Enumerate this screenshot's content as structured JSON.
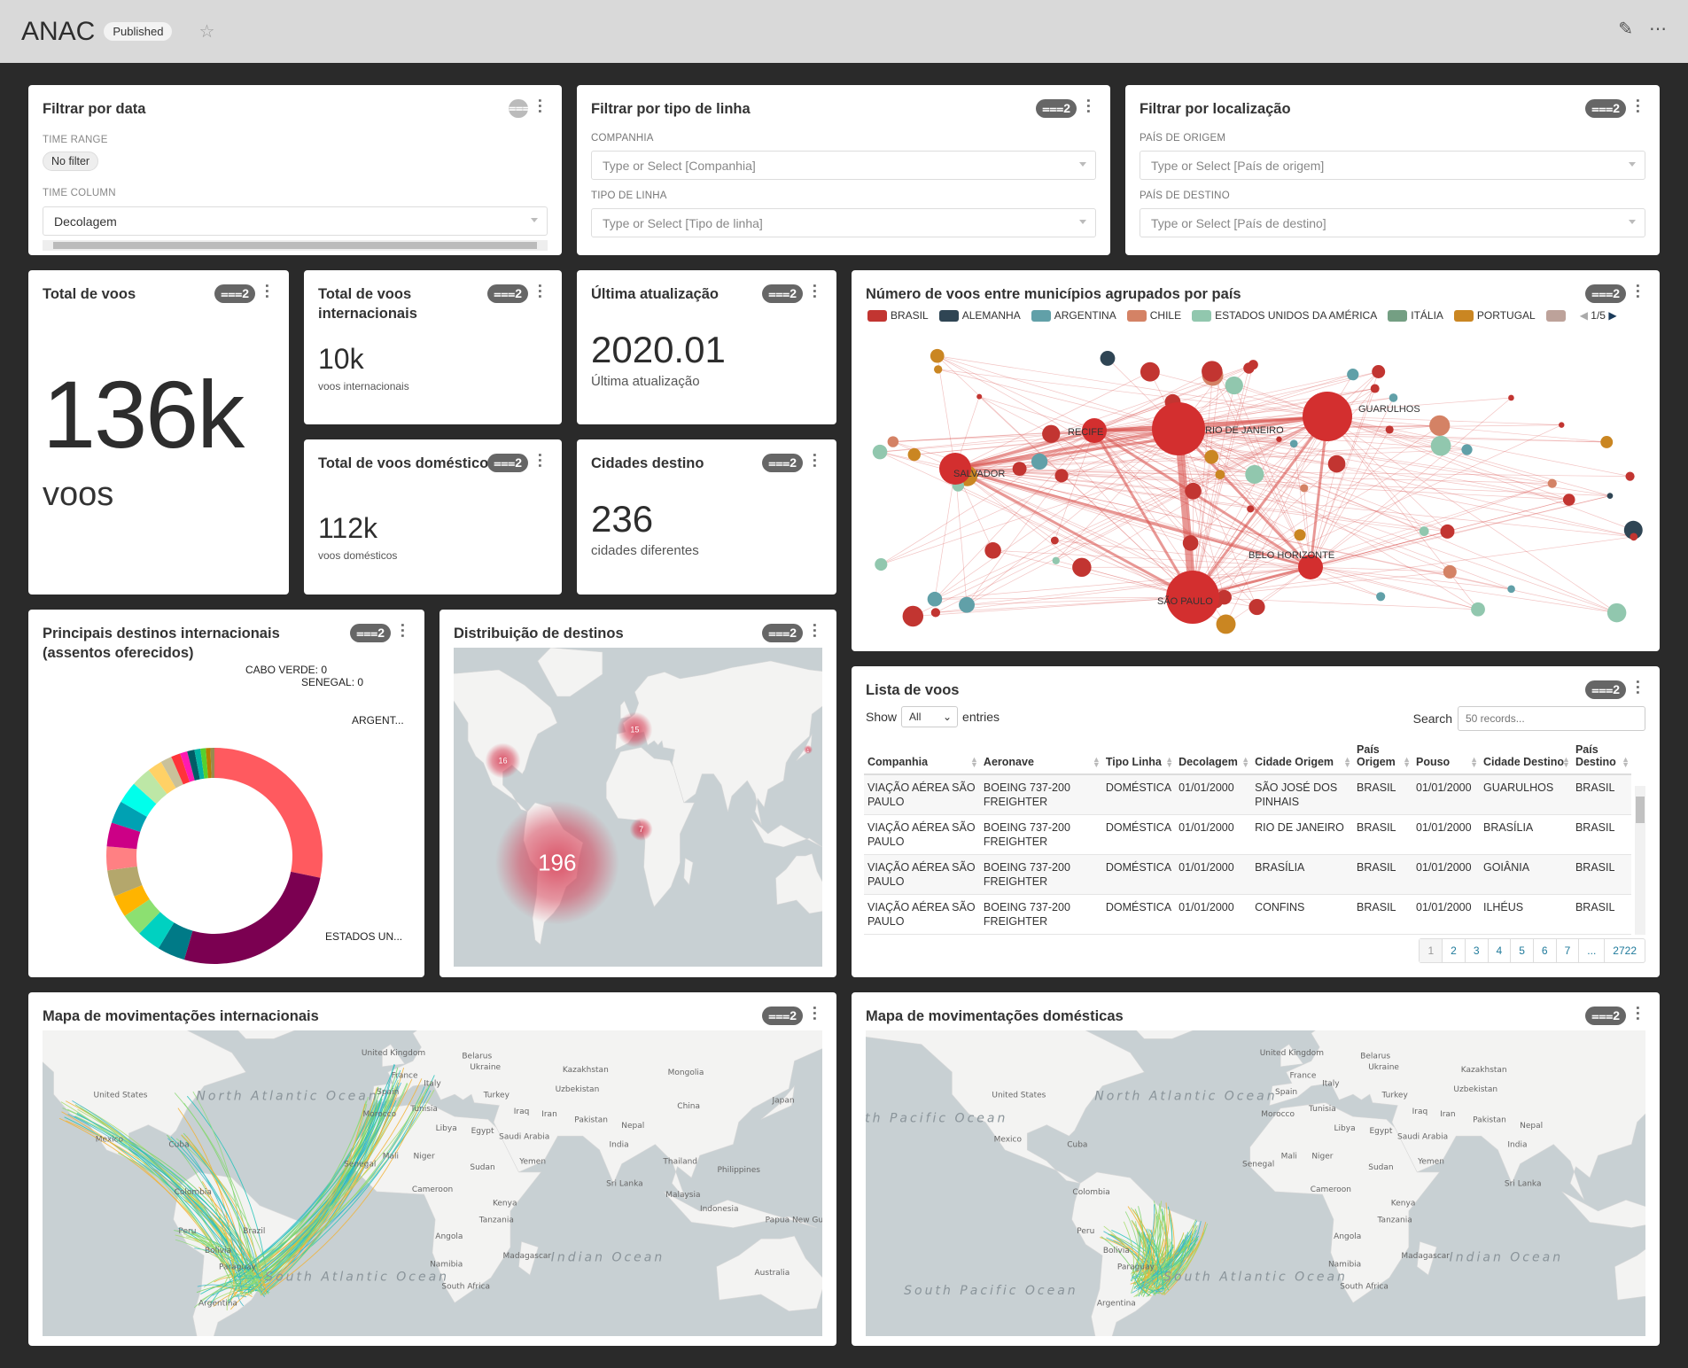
{
  "header": {
    "title": "ANAC",
    "status": "Published",
    "icons": [
      "star-icon",
      "edit-icon",
      "more-icon"
    ]
  },
  "filter_date": {
    "title": "Filtrar por data",
    "time_range_label": "TIME RANGE",
    "time_range_value": "No filter",
    "time_column_label": "TIME COLUMN",
    "time_column_value": "Decolagem"
  },
  "filter_line": {
    "title": "Filtrar por tipo de linha",
    "badge": "2",
    "companhia_label": "COMPANHIA",
    "companhia_placeholder": "Type or Select [Companhia]",
    "tipo_label": "TIPO DE LINHA",
    "tipo_placeholder": "Type or Select [Tipo de linha]"
  },
  "filter_loc": {
    "title": "Filtrar por localização",
    "badge": "2",
    "origem_label": "PAÍS DE ORIGEM",
    "origem_placeholder": "Type or Select [País de origem]",
    "destino_label": "PAÍS DE DESTINO",
    "destino_placeholder": "Type or Select [País de destino]"
  },
  "total_voos": {
    "title": "Total de voos",
    "badge": "2",
    "value": "136k",
    "unit": "voos"
  },
  "internacionais": {
    "title": "Total de voos internacionais",
    "badge": "2",
    "value": "10k",
    "subtitle": "voos internacionais"
  },
  "domesticos": {
    "title": "Total de voos domésticos",
    "badge": "2",
    "value": "112k",
    "subtitle": "voos domésticos"
  },
  "ultima": {
    "title": "Última atualização",
    "badge": "2",
    "value": "2020.01",
    "subtitle": "Última atualização"
  },
  "cidades": {
    "title": "Cidades destino",
    "badge": "2",
    "value": "236",
    "subtitle": "cidades diferentes"
  },
  "network": {
    "title": "Número de voos entre municípios agrupados por país",
    "badge": "2",
    "page": "1/5",
    "legend": [
      {
        "label": "BRASIL",
        "color": "#c23531"
      },
      {
        "label": "ALEMANHA",
        "color": "#2f4554"
      },
      {
        "label": "ARGENTINA",
        "color": "#61a0a8"
      },
      {
        "label": "CHILE",
        "color": "#d48265"
      },
      {
        "label": "ESTADOS UNIDOS DA AMÉRICA",
        "color": "#91c7ae"
      },
      {
        "label": "ITÁLIA",
        "color": "#749f83"
      },
      {
        "label": "PORTUGAL",
        "color": "#ca8622"
      },
      {
        "label": "",
        "color": "#bda29a"
      }
    ],
    "cities": [
      "RECIFE",
      "RIO DE JANEIRO",
      "GUARULHOS",
      "SALVADOR",
      "BELO HORIZONTE",
      "SÃO PAULO"
    ]
  },
  "donut": {
    "title": "Principais destinos internacionais (assentos oferecidos)",
    "badge": "2",
    "chart_data": {
      "type": "pie",
      "labels_shown": [
        "CABO VERDE: 0",
        "SENEGAL: 0",
        "ARGENT...",
        "ESTADOS UN..."
      ],
      "slices": [
        {
          "label": "ARGENTINA",
          "value": 28.5,
          "color": "#ff5a5f"
        },
        {
          "label": "ESTADOS UNIDOS",
          "value": 26.5,
          "color": "#7b0051"
        },
        {
          "value": 4.2,
          "color": "#007a87"
        },
        {
          "value": 3.6,
          "color": "#00d1c1"
        },
        {
          "value": 3.4,
          "color": "#8ce071"
        },
        {
          "value": 3.3,
          "color": "#ffb400"
        },
        {
          "value": 4.0,
          "color": "#b4a76c"
        },
        {
          "value": 3.6,
          "color": "#ff8083"
        },
        {
          "value": 3.6,
          "color": "#cc0086"
        },
        {
          "value": 3.4,
          "color": "#00a1b3"
        },
        {
          "value": 3.3,
          "color": "#00ffeb"
        },
        {
          "value": 3.0,
          "color": "#bde7a6"
        },
        {
          "value": 2.2,
          "color": "#ffd166"
        },
        {
          "value": 1.7,
          "color": "#c9c19a"
        },
        {
          "value": 1.4,
          "color": "#ff3339"
        },
        {
          "value": 1.1,
          "color": "#ff1ab1"
        },
        {
          "value": 1.1,
          "color": "#005c66"
        },
        {
          "value": 0.9,
          "color": "#00b3a5"
        },
        {
          "value": 0.8,
          "color": "#55d12e"
        },
        {
          "value": 0.7,
          "color": "#b37e00"
        },
        {
          "value": 0.6,
          "color": "#988b4e"
        }
      ]
    }
  },
  "distribuicao": {
    "title": "Distribuição de destinos",
    "badge": "2",
    "clusters": [
      {
        "count": "196"
      },
      {
        "count": "16"
      },
      {
        "count": "15"
      },
      {
        "count": "7"
      },
      {
        "count": "1"
      }
    ]
  },
  "lista": {
    "title": "Lista de voos",
    "badge": "2",
    "show_label": "Show",
    "show_value": "All",
    "entries_label": "entries",
    "search_label": "Search",
    "search_placeholder": "50 records...",
    "columns": [
      "Companhia",
      "Aeronave",
      "Tipo Linha",
      "Decolagem",
      "Cidade Origem",
      "País Origem",
      "Pouso",
      "Cidade Destino",
      "País Destino"
    ],
    "rows": [
      [
        "VIAÇÃO AÉREA SÃO PAULO",
        "BOEING 737-200 FREIGHTER",
        "DOMÉSTICA",
        "01/01/2000",
        "SÃO JOSÉ DOS PINHAIS",
        "BRASIL",
        "01/01/2000",
        "GUARULHOS",
        "BRASIL"
      ],
      [
        "VIAÇÃO AÉREA SÃO PAULO",
        "BOEING 737-200 FREIGHTER",
        "DOMÉSTICA",
        "01/01/2000",
        "RIO DE JANEIRO",
        "BRASIL",
        "01/01/2000",
        "BRASÍLIA",
        "BRASIL"
      ],
      [
        "VIAÇÃO AÉREA SÃO PAULO",
        "BOEING 737-200 FREIGHTER",
        "DOMÉSTICA",
        "01/01/2000",
        "BRASÍLIA",
        "BRASIL",
        "01/01/2000",
        "GOIÂNIA",
        "BRASIL"
      ],
      [
        "VIAÇÃO AÉREA SÃO PAULO",
        "BOEING 737-200 FREIGHTER",
        "DOMÉSTICA",
        "01/01/2000",
        "CONFINS",
        "BRASIL",
        "01/01/2000",
        "ILHÉUS",
        "BRASIL"
      ]
    ],
    "pages": [
      "1",
      "2",
      "3",
      "4",
      "5",
      "6",
      "7",
      "...",
      "2722"
    ]
  },
  "mapa_int": {
    "title": "Mapa de movimentações internacionais",
    "badge": "2",
    "labels": [
      "United States",
      "Mexico",
      "Cuba",
      "Colombia",
      "Peru",
      "Brazil",
      "Bolivia",
      "Paraguay",
      "Argentina",
      "United Kingdom",
      "France",
      "Spain",
      "Italy",
      "Morocco",
      "Belarus",
      "Ukraine",
      "Kazakhstan",
      "Mongolia",
      "Uzbekistan",
      "Turkey",
      "Tunisia",
      "Iraq",
      "Iran",
      "China",
      "Japan",
      "Libya",
      "Egypt",
      "Saudi Arabia",
      "Pakistan",
      "Nepal",
      "India",
      "Mali",
      "Niger",
      "Senegal",
      "Yemen",
      "Sudan",
      "Thailand",
      "Philippines",
      "Sri Lanka",
      "Malaysia",
      "Cameroon",
      "Kenya",
      "Indonesia",
      "Tanzania",
      "Papua New Guinea",
      "Angola",
      "Namibia",
      "Madagascar",
      "South Africa",
      "Australia"
    ],
    "oceans": [
      "North Atlantic Ocean",
      "South Atlantic Ocean",
      "Indian Ocean"
    ]
  },
  "mapa_dom": {
    "title": "Mapa de movimentações domésticas",
    "badge": "2",
    "labels": [
      "United States",
      "Mexico",
      "Cuba",
      "Colombia",
      "Peru",
      "Bolivia",
      "Paraguay",
      "Argentina",
      "United Kingdom",
      "France",
      "Spain",
      "Italy",
      "Morocco",
      "Belarus",
      "Ukraine",
      "Kazakhstan",
      "Uzbekistan",
      "Turkey",
      "Tunisia",
      "Iraq",
      "Iran",
      "Libya",
      "Egypt",
      "Saudi Arabia",
      "Pakistan",
      "Nepal",
      "India",
      "Mali",
      "Niger",
      "Senegal",
      "Yemen",
      "Sudan",
      "Sri Lanka",
      "Cameroon",
      "Kenya",
      "Tanzania",
      "Angola",
      "Namibia",
      "Madagascar",
      "South Africa"
    ],
    "oceans": [
      "North Pacific Ocean",
      "North Atlantic Ocean",
      "South Atlantic Ocean",
      "South Pacific Ocean",
      "Indian Ocean"
    ]
  }
}
